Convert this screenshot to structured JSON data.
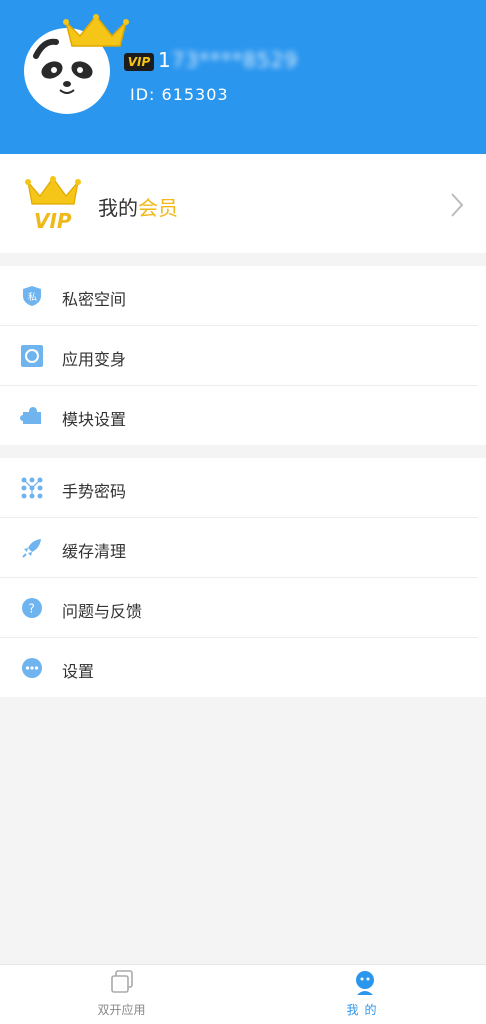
{
  "profile": {
    "vip_badge": "VIP",
    "phone_prefix": "1",
    "phone_masked": "73****8529",
    "id_text": "ID: 615303"
  },
  "vip_card": {
    "title_plain": "我的",
    "title_accent": "会员",
    "accent_color": "#f0b91a"
  },
  "menu_group_1": [
    {
      "label": "私密空间",
      "icon": "shield-icon"
    },
    {
      "label": "应用变身",
      "icon": "refresh-icon"
    },
    {
      "label": "模块设置",
      "icon": "puzzle-icon"
    }
  ],
  "menu_group_2": [
    {
      "label": "手势密码",
      "icon": "gesture-grid-icon"
    },
    {
      "label": "缓存清理",
      "icon": "rocket-icon"
    },
    {
      "label": "问题与反馈",
      "icon": "feedback-icon"
    },
    {
      "label": "设置",
      "icon": "settings-dots-icon"
    }
  ],
  "tabbar": {
    "tab1_label": "双开应用",
    "tab2_label": "我的"
  },
  "colors": {
    "header_bg": "#2b96ee",
    "active_tab": "#2b96ee"
  }
}
